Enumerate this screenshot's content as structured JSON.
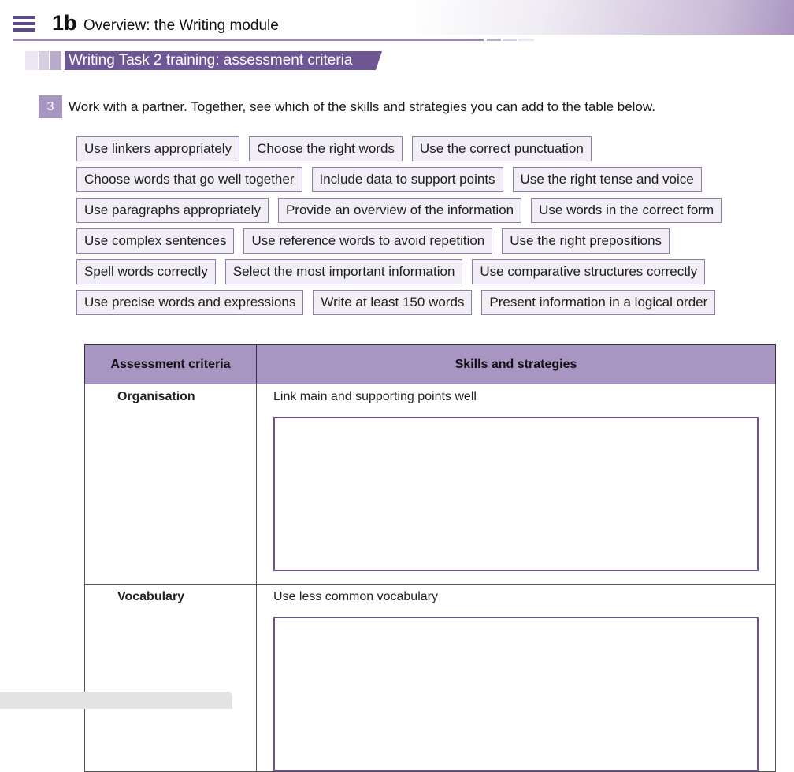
{
  "header": {
    "unit_number": "1b",
    "unit_title": "Overview: the Writing module"
  },
  "section": {
    "title": "Writing Task 2 training: assessment criteria"
  },
  "question": {
    "number": "3",
    "text": "Work with a partner. Together, see which of the skills and strategies you can add to the table below."
  },
  "chips": [
    [
      "Use linkers appropriately",
      "Choose the right words",
      "Use the correct punctuation"
    ],
    [
      "Choose words that go well together",
      "Include data to support points",
      "Use the right tense and voice"
    ],
    [
      "Use paragraphs appropriately",
      "Provide an overview of the information",
      "Use words in the correct form"
    ],
    [
      "Use complex sentences",
      "Use reference words to avoid repetition",
      "Use the right prepositions"
    ],
    [
      "Spell words correctly",
      "Select the most important information",
      "Use comparative structures correctly"
    ],
    [
      "Use precise words and expressions",
      "Write at least 150 words",
      "Present information in a logical order"
    ]
  ],
  "table": {
    "headers": [
      "Assessment criteria",
      "Skills and strategies"
    ],
    "rows": [
      {
        "criterion": "Organisation",
        "example": "Link main and supporting points well"
      },
      {
        "criterion": "Vocabulary",
        "example": "Use less common vocabulary"
      }
    ]
  },
  "colors": {
    "accent": "#6f5694",
    "header_fill": "#a895c2",
    "chip_fill": "#f1eef6",
    "chip_border": "#8f7ca8"
  },
  "icons": {
    "menu": "hamburger-menu-icon"
  }
}
